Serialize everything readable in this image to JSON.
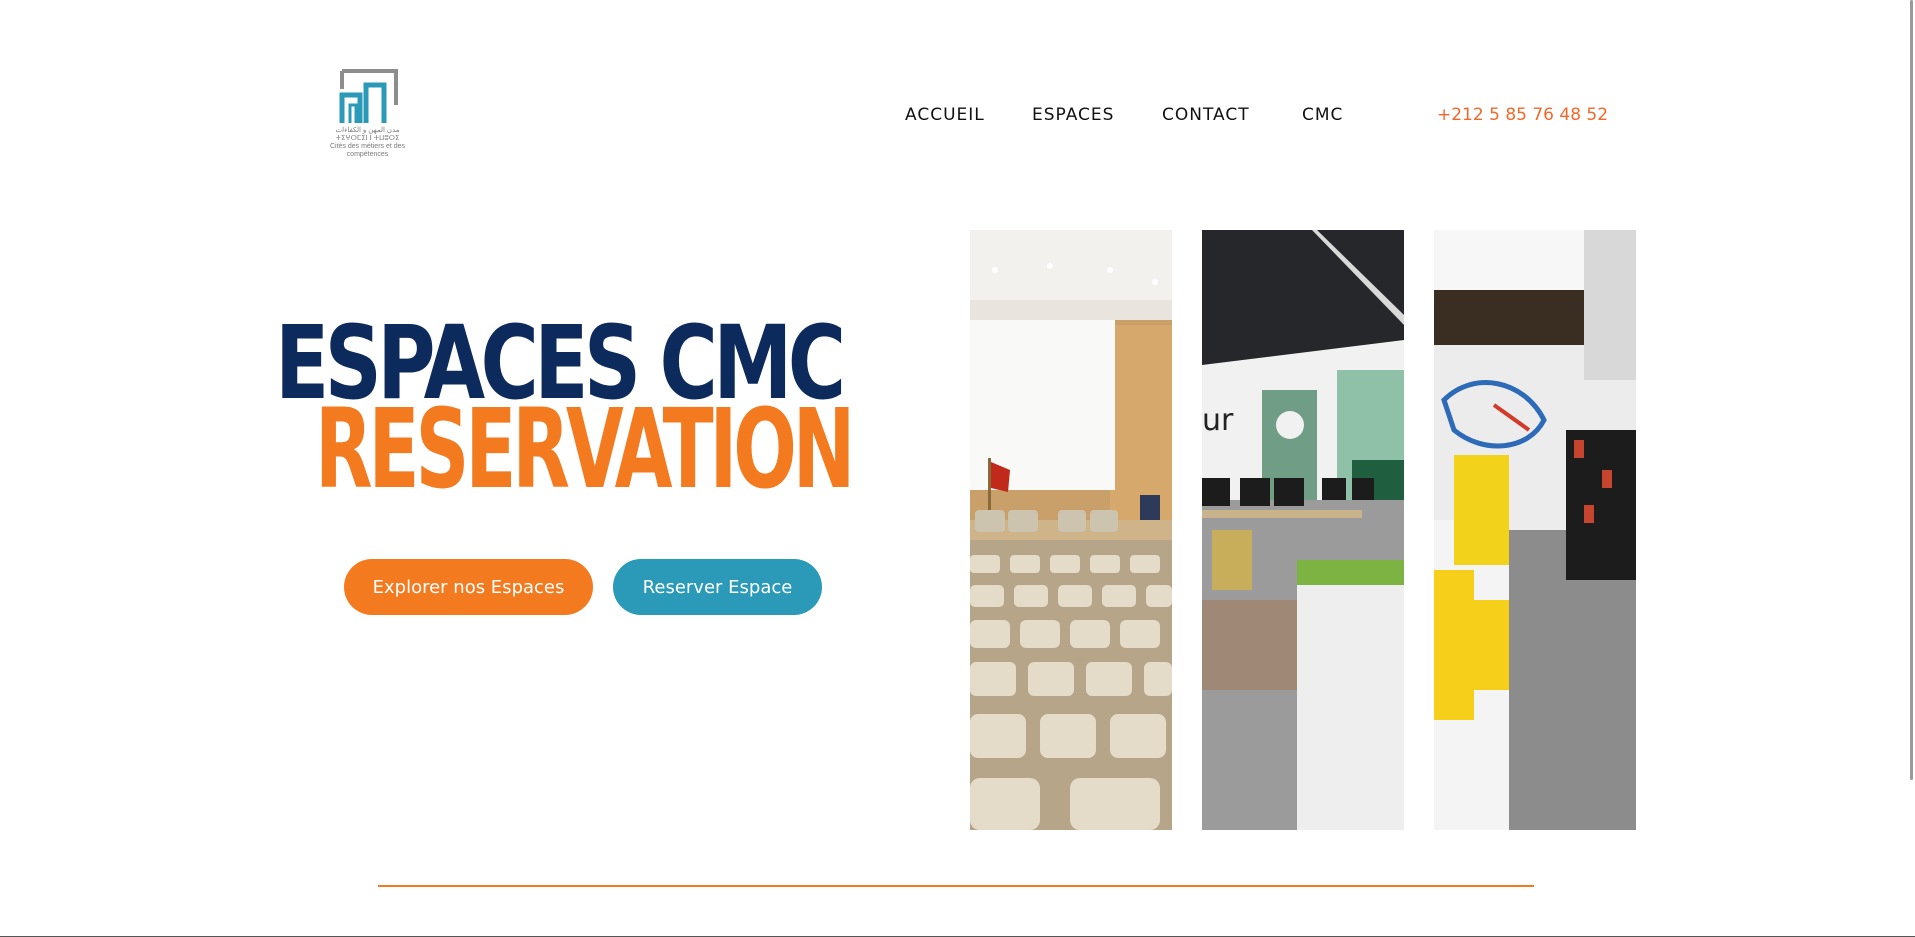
{
  "header": {
    "logo": {
      "name": "cmc-logo",
      "caption_arabic": "مدن المهن و الكفاءات",
      "caption_tifinagh": "ⵜⵉⵖⵔⵎⵉⵏ ⵏ ⵜⵡⵓⵔⵉ",
      "caption_french": "Cités des métiers et des compétences"
    },
    "nav": [
      {
        "label": "ACCUEIL"
      },
      {
        "label": "ESPACES"
      },
      {
        "label": "CONTACT"
      },
      {
        "label": "CMC"
      }
    ],
    "phone": "+212 5 85 76 48 52"
  },
  "hero": {
    "title_line1": "ESPACES CMC",
    "title_line2": "RESERVATION",
    "buttons": {
      "explore": "Explorer nos Espaces",
      "reserve": "Reserver Espace"
    }
  },
  "gallery": [
    {
      "name": "auditorium-photo"
    },
    {
      "name": "computer-room-photo"
    },
    {
      "name": "library-photo"
    }
  ],
  "colors": {
    "navy": "#0d2a5c",
    "orange": "#f47a20",
    "teal": "#2a9ab8",
    "phone": "#f2682b"
  }
}
